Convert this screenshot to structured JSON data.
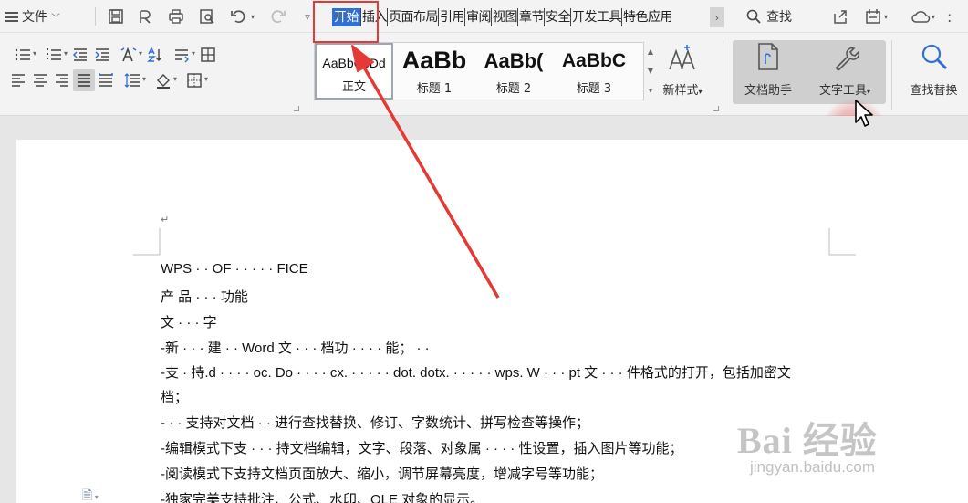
{
  "menubar": {
    "file_label": "文件",
    "tabs": [
      {
        "label": "开始",
        "active": true
      },
      {
        "label": "插入",
        "active": false
      },
      {
        "label": "页面布局",
        "active": false
      },
      {
        "label": "引用",
        "active": false
      },
      {
        "label": "审阅",
        "active": false
      },
      {
        "label": "视图",
        "active": false
      },
      {
        "label": "章节",
        "active": false
      },
      {
        "label": "安全",
        "active": false
      },
      {
        "label": "开发工具",
        "active": false
      },
      {
        "label": "特色应用",
        "active": false
      }
    ],
    "search_label": "查找"
  },
  "ribbon": {
    "styles": [
      {
        "sample": "AaBbCcDd",
        "label": "正文",
        "selected": true
      },
      {
        "sample": "AaBb",
        "label": "标题 1",
        "selected": false
      },
      {
        "sample": "AaBb(",
        "label": "标题 2",
        "selected": false
      },
      {
        "sample": "AaBbC",
        "label": "标题 3",
        "selected": false
      }
    ],
    "new_style_label": "新样式",
    "doc_helper_label": "文档助手",
    "text_tools_label": "文字工具",
    "find_replace_label": "查找替换"
  },
  "document": {
    "lines": [
      "WPS · · OF · · · · · FICE",
      "产 品 · · · 功能",
      "文 · · · 字",
      "-新 · · · 建 · · Word 文 · · · 档功 · · · · 能； · · ",
      "-支 · 持.d · · · · oc. Do · · · · cx. · · · · · dot. dotx. · · · · · wps. W · · · pt 文 · · · 件格式的打开，包括加密文",
      "档；",
      "- · · 支持对文档 · · 进行查找替换、修订、字数统计、拼写检查等操作；",
      "-编辑模式下支 · · · 持文档编辑，文字、段落、对象属 · · · · 性设置，插入图片等功能；",
      "-阅读模式下支持文档页面放大、缩小，调节屏幕亮度，增减字号等功能；",
      "-独家完美支持批注、公式、水印、OLE 对象的显示。"
    ]
  },
  "watermark": {
    "logo": "Bai 经验",
    "url": "jingyan.baidu.com"
  },
  "colors": {
    "active_tab": "#2f6fd6",
    "annotation_red": "#e53935"
  }
}
